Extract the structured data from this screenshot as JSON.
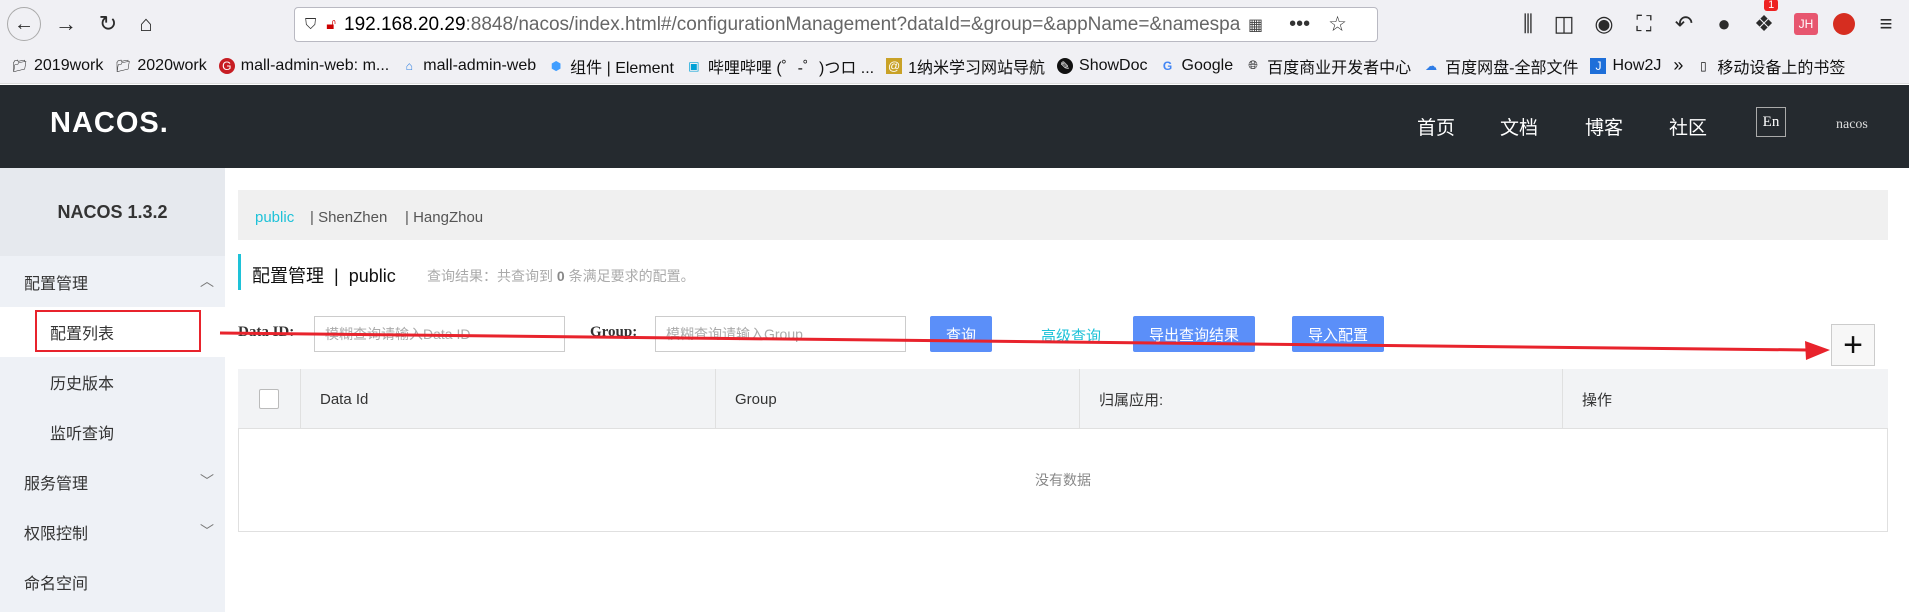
{
  "browser": {
    "url_host": "192.168.20.29",
    "url_rest": ":8848/nacos/index.html#/configurationManagement?dataId=&group=&appName=&namespa",
    "bookmarks": [
      {
        "label": "2019work",
        "icon": "folder-icon"
      },
      {
        "label": "2020work",
        "icon": "folder-icon"
      },
      {
        "label": "mall-admin-web: m...",
        "icon": "gitee-icon"
      },
      {
        "label": "mall-admin-web",
        "icon": "shop-icon"
      },
      {
        "label": "组件 | Element",
        "icon": "element-icon"
      },
      {
        "label": "哔哩哔哩 (゜-゜)つロ ...",
        "icon": "bilibili-icon"
      },
      {
        "label": "1纳米学习网站导航",
        "icon": "nano-icon"
      },
      {
        "label": "ShowDoc",
        "icon": "showdoc-icon"
      },
      {
        "label": "Google",
        "icon": "google-icon"
      },
      {
        "label": "百度商业开发者中心",
        "icon": "globe-icon"
      },
      {
        "label": "百度网盘-全部文件",
        "icon": "baidu-pan-icon"
      },
      {
        "label": "How2J",
        "icon": "how2j-icon"
      }
    ],
    "bookmarks_more": "移动设备上的书签",
    "badge_count": "1",
    "avatar_initials": "JH"
  },
  "nacos": {
    "logo": "NACOS.",
    "nav": [
      "首页",
      "文档",
      "博客",
      "社区"
    ],
    "lang_button": "En",
    "user": "nacos",
    "version_title": "NACOS 1.3.2"
  },
  "sidebar": {
    "config_mgmt": "配置管理",
    "config_list": "配置列表",
    "history": "历史版本",
    "listen_query": "监听查询",
    "service_mgmt": "服务管理",
    "auth_control": "权限控制",
    "namespace": "命名空间"
  },
  "namespaces": {
    "active": "public",
    "others": [
      "ShenZhen",
      "HangZhou"
    ]
  },
  "page": {
    "title": "配置管理",
    "separator": "|",
    "namespace": "public",
    "result_prefix": "查询结果：共查询到 ",
    "result_count": "0",
    "result_suffix": " 条满足要求的配置。"
  },
  "search": {
    "dataid_label": "Data ID:",
    "dataid_placeholder": "模糊查询请输入Data ID",
    "group_label": "Group:",
    "group_placeholder": "模糊查询请输入Group",
    "query_button": "查询",
    "advanced_link": "高级查询",
    "export_button": "导出查询结果",
    "import_button": "导入配置",
    "add_button": "+"
  },
  "table": {
    "headers": [
      "Data Id",
      "Group",
      "归属应用:",
      "操作"
    ],
    "empty_text": "没有数据"
  },
  "colors": {
    "header_bg": "#252a2f",
    "accent": "#1ec2d8",
    "button_blue": "#5b8ff9",
    "annotation_red": "#e8232c"
  }
}
